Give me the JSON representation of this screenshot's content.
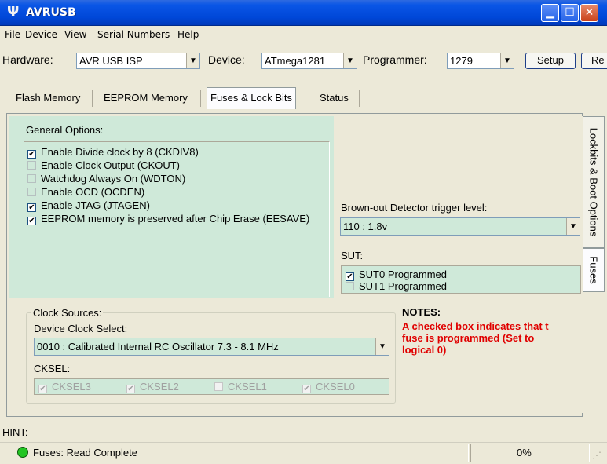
{
  "window": {
    "title": "AVRUSB",
    "icon": "avr-app-icon"
  },
  "menu": [
    "File",
    "Device",
    "View",
    "Serial Numbers",
    "Help"
  ],
  "toolbar": {
    "hardware_label": "Hardware:",
    "hardware_value": "AVR USB ISP",
    "device_label": "Device:",
    "device_value": "ATmega1281",
    "programmer_label": "Programmer:",
    "programmer_value": "1279",
    "setup_label": "Setup",
    "read_label": "Re"
  },
  "tabs": [
    "Flash Memory",
    "EEPROM Memory",
    "Fuses & Lock Bits",
    "Status"
  ],
  "side_tabs": [
    "Lockbits & Boot Options",
    "Fuses"
  ],
  "general": {
    "title": "General Options:",
    "options": [
      {
        "label": "Enable Divide clock by 8 (CKDIV8)",
        "checked": true
      },
      {
        "label": "Enable Clock Output (CKOUT)",
        "checked": false
      },
      {
        "label": "Watchdog Always On (WDTON)",
        "checked": false
      },
      {
        "label": "Enable OCD (OCDEN)",
        "checked": false
      },
      {
        "label": "Enable JTAG (JTAGEN)",
        "checked": true
      },
      {
        "label": "EEPROM memory is preserved after Chip Erase (EESAVE)",
        "checked": true
      }
    ]
  },
  "bod": {
    "label": "Brown-out Detector trigger level:",
    "value": "110 : 1.8v"
  },
  "sut": {
    "label": "SUT:",
    "options": [
      {
        "label": "SUT0 Programmed",
        "checked": true
      },
      {
        "label": "SUT1 Programmed",
        "checked": false
      }
    ]
  },
  "clock": {
    "group_title": "Clock Sources:",
    "select_label": "Device Clock Select:",
    "select_value": "0010 : Calibrated Internal RC Oscillator 7.3 - 8.1 MHz",
    "cksel_label": "CKSEL:",
    "cksel": [
      {
        "label": "CKSEL3",
        "checked": true
      },
      {
        "label": "CKSEL2",
        "checked": true
      },
      {
        "label": "CKSEL1",
        "checked": false
      },
      {
        "label": "CKSEL0",
        "checked": true
      }
    ]
  },
  "notes": {
    "title": "NOTES:",
    "lines": [
      "A checked box indicates that t",
      "fuse is programmed (Set to",
      "logical 0)"
    ]
  },
  "hint_label": "HINT:",
  "status": {
    "text": "Fuses: Read Complete",
    "percent": "0%",
    "indicator_color": "#22c522"
  }
}
